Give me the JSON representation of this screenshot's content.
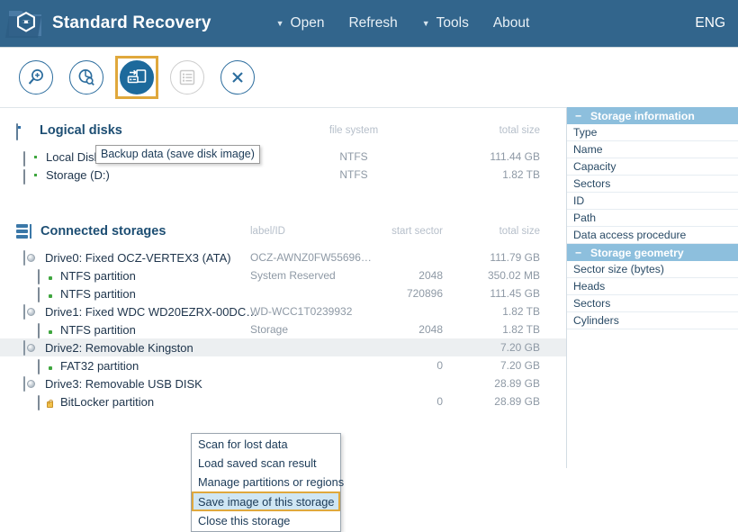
{
  "header": {
    "app_title": "Standard Recovery",
    "logo_icon": "cube-folder-logo-icon",
    "menu": [
      {
        "label": "Open",
        "caret": "▼",
        "has_caret": true
      },
      {
        "label": "Refresh",
        "caret": "",
        "has_caret": false
      },
      {
        "label": "Tools",
        "caret": "▼",
        "has_caret": true
      },
      {
        "label": "About",
        "caret": "",
        "has_caret": false
      }
    ],
    "language": "ENG",
    "bg_color": "#32658c"
  },
  "toolbar": {
    "buttons": [
      {
        "name": "scan-for-lost-data-button",
        "icon": "magnifier-plus-icon",
        "state": "normal"
      },
      {
        "name": "disk-analysis-button",
        "icon": "pie-chart-search-icon",
        "state": "normal"
      },
      {
        "name": "backup-data-button",
        "icon": "save-disk-image-icon",
        "state": "selected"
      },
      {
        "name": "view-list-button",
        "icon": "list-lines-icon",
        "state": "disabled"
      },
      {
        "name": "close-storage-button",
        "icon": "close-x-icon",
        "state": "normal"
      }
    ],
    "tooltip": "Backup data (save disk image)",
    "highlight_color": "#e0a83c"
  },
  "logical_disks": {
    "title": "Logical disks",
    "icon": "monitor-icon",
    "columns": {
      "file_system": "file system",
      "total_size": "total size"
    },
    "rows": [
      {
        "icon": "hdd-icon",
        "name": "Local Disk (C:)",
        "file_system": "NTFS",
        "total_size": "111.44 GB"
      },
      {
        "icon": "hdd-icon",
        "name": "Storage (D:)",
        "file_system": "NTFS",
        "total_size": "1.82 TB"
      }
    ]
  },
  "connected_storages": {
    "title": "Connected storages",
    "icon": "stacked-bars-icon",
    "columns": {
      "label_id": "label/ID",
      "start_sector": "start sector",
      "total_size": "total size"
    },
    "rows": [
      {
        "icon": "drive-icon",
        "level": "drive",
        "name": "Drive0: Fixed OCZ-VERTEX3 (ATA)",
        "label_id": "OCZ-AWNZ0FW55696…",
        "start_sector": "",
        "total_size": "111.79 GB",
        "selected": false
      },
      {
        "icon": "partition-icon",
        "level": "partition",
        "name": "NTFS partition",
        "label_id": "System Reserved",
        "start_sector": "2048",
        "total_size": "350.02 MB",
        "selected": false
      },
      {
        "icon": "partition-icon",
        "level": "partition",
        "name": "NTFS partition",
        "label_id": "",
        "start_sector": "720896",
        "total_size": "111.45 GB",
        "selected": false
      },
      {
        "icon": "drive-icon",
        "level": "drive",
        "name": "Drive1: Fixed WDC WD20EZRX-00DC…",
        "label_id": "WD-WCC1T0239932",
        "start_sector": "",
        "total_size": "1.82 TB",
        "selected": false
      },
      {
        "icon": "partition-icon",
        "level": "partition",
        "name": "NTFS partition",
        "label_id": "Storage",
        "start_sector": "2048",
        "total_size": "1.82 TB",
        "selected": false
      },
      {
        "icon": "drive-icon",
        "level": "drive",
        "name": "Drive2: Removable Kingston",
        "label_id": "",
        "start_sector": "",
        "total_size": "7.20 GB",
        "selected": true
      },
      {
        "icon": "partition-icon",
        "level": "partition",
        "name": "FAT32 partition",
        "label_id": "",
        "start_sector": "0",
        "total_size": "7.20 GB",
        "selected": false
      },
      {
        "icon": "drive-icon",
        "level": "drive",
        "name": "Drive3: Removable USB DISK",
        "label_id": "",
        "start_sector": "",
        "total_size": "28.89 GB",
        "selected": false
      },
      {
        "icon": "partition-lock-icon",
        "level": "partition",
        "name": "BitLocker partition",
        "label_id": "",
        "start_sector": "0",
        "total_size": "28.89 GB",
        "selected": false
      }
    ]
  },
  "context_menu": {
    "items": [
      {
        "label": "Scan for lost data",
        "active": false
      },
      {
        "label": "Load saved scan result",
        "active": false
      },
      {
        "label": "Manage partitions or regions",
        "active": false
      },
      {
        "label": "Save image of this storage",
        "active": true
      },
      {
        "label": "Close this storage",
        "active": false
      }
    ],
    "active_bg": "#cfe6f4",
    "active_border": "#e0a83c"
  },
  "right_panel": {
    "sections": [
      {
        "title": "Storage information",
        "collapse_glyph": "−",
        "rows": [
          "Type",
          "Name",
          "Capacity",
          "Sectors",
          "ID",
          "Path",
          "Data access procedure"
        ]
      },
      {
        "title": "Storage geometry",
        "collapse_glyph": "−",
        "rows": [
          "Sector size (bytes)",
          "Heads",
          "Sectors",
          "Cylinders"
        ]
      }
    ],
    "header_bg": "#8dbfdd"
  }
}
